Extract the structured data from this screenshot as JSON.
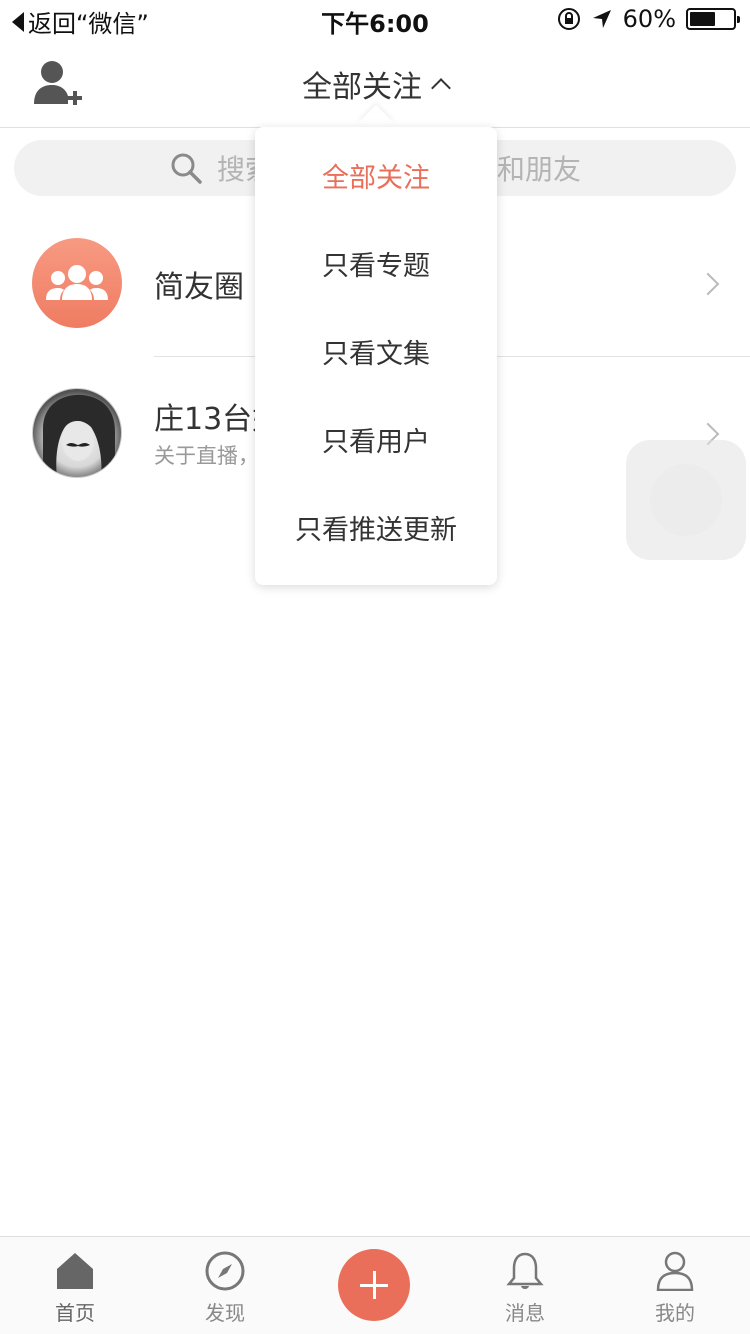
{
  "status_bar": {
    "back_label": "返回“微信”",
    "time": "下午6:00",
    "battery": "60%",
    "battery_level": 0.6,
    "icons": [
      "orientation-lock-icon",
      "location-arrow-icon",
      "battery-icon"
    ]
  },
  "nav": {
    "title": "全部关注",
    "left_icon": "add-user-icon",
    "title_icon": "chevron-up-icon"
  },
  "search": {
    "placeholder": "搜索用户、专题、文集和朋友",
    "icon": "search-icon"
  },
  "list": {
    "items": [
      {
        "title": "简友圈",
        "subtitle": "",
        "icon": "group-icon"
      },
      {
        "title": "庄13台妹PKGIRL",
        "subtitle": "关于直播，那些人不会告诉你的事",
        "icon": "avatar-photo"
      }
    ]
  },
  "dropdown": {
    "items": [
      {
        "label": "全部关注",
        "active": true
      },
      {
        "label": "只看专题",
        "active": false
      },
      {
        "label": "只看文集",
        "active": false
      },
      {
        "label": "只看用户",
        "active": false
      },
      {
        "label": "只看推送更新",
        "active": false
      }
    ]
  },
  "tabbar": {
    "tabs": [
      {
        "label": "首页",
        "icon": "home-icon"
      },
      {
        "label": "发现",
        "icon": "compass-icon"
      },
      {
        "label": "",
        "icon": "plus-icon"
      },
      {
        "label": "消息",
        "icon": "bell-icon"
      },
      {
        "label": "我的",
        "icon": "person-icon"
      }
    ]
  },
  "colors": {
    "accent": "#ea6f5a",
    "text": "#333333",
    "muted": "#999999"
  }
}
